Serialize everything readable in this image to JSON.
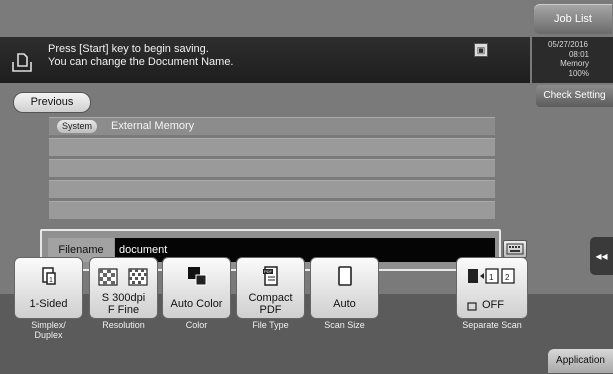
{
  "header": {
    "job_list": "Job List",
    "check_setting": "Check Setting"
  },
  "message": {
    "line1": "Press [Start] key to begin saving.",
    "line2": "You can change the Document Name."
  },
  "status": {
    "date": "05/27/2016",
    "time": "08:01",
    "memory_label": "Memory",
    "memory_value": "100%"
  },
  "navigation": {
    "previous": "Previous"
  },
  "destination": {
    "badge": "System",
    "name": "External Memory"
  },
  "filename": {
    "label": "Filename",
    "value": "document"
  },
  "functions": [
    {
      "value": "1-Sided",
      "label": "Simplex/\nDuplex"
    },
    {
      "value": "S 300dpi\nF Fine",
      "label": "Resolution"
    },
    {
      "value": "Auto Color",
      "label": "Color"
    },
    {
      "value": "Compact\nPDF",
      "label": "File Type"
    },
    {
      "value": "Auto",
      "label": "Scan Size"
    }
  ],
  "separate_scan": {
    "value": "OFF",
    "label": "Separate Scan"
  },
  "application": "Application",
  "colors": {
    "message_bar": "#242424",
    "filename_field": "#050505",
    "button_face": "#e6e6e6"
  },
  "icons": [
    "save-document-icon",
    "memory-card-icon",
    "keyboard-icon",
    "collapse-arrow-icon",
    "simplex-icon",
    "resolution-icon",
    "color-icon",
    "pdf-file-icon",
    "paper-size-icon",
    "separate-scan-icon"
  ]
}
